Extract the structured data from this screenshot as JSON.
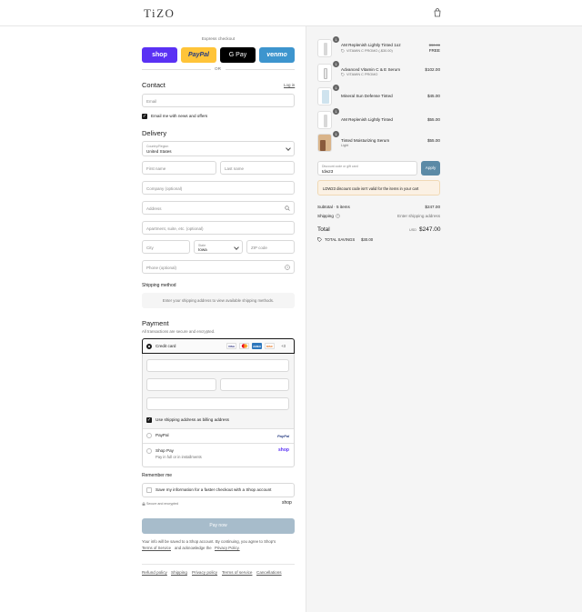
{
  "header": {
    "logo": "TiZO"
  },
  "express": {
    "label": "Express checkout",
    "buttons": [
      "shop",
      "PayPal",
      "G Pay",
      "venmo"
    ],
    "or": "OR"
  },
  "contact": {
    "title": "Contact",
    "login": "Log in",
    "email_placeholder": "Email",
    "newsletter": "Email me with news and offers"
  },
  "delivery": {
    "title": "Delivery",
    "country_label": "Country/Region",
    "country_value": "United States",
    "first_name": "First name",
    "last_name": "Last name",
    "company": "Company (optional)",
    "address": "Address",
    "apartment": "Apartment, suite, etc. (optional)",
    "city": "City",
    "state_label": "State",
    "state_value": "Iowa",
    "zip": "ZIP code",
    "phone": "Phone (optional)"
  },
  "shipping": {
    "title": "Shipping method",
    "message": "Enter your shipping address to view available shipping methods."
  },
  "payment": {
    "title": "Payment",
    "subtitle": "All transactions are secure and encrypted.",
    "credit_card": "Credit card",
    "card_more": "+3",
    "billing_same": "Use shipping address as billing address",
    "paypal": "PayPal",
    "shop_pay": "Shop Pay",
    "shop_pay_sub": "Pay in full or in installments"
  },
  "remember": {
    "title": "Remember me",
    "save_info": "Save my information for a faster checkout with a Shop account",
    "secure": "Secure and encrypted",
    "shop": "shop"
  },
  "pay_now": "Pay now",
  "legal": {
    "line1": "Your info will be saved to a Shop account. By continuing, you agree to Shop's",
    "tos": "Terms of Service",
    "and": "and acknowledge the",
    "privacy": "Privacy Policy."
  },
  "footer": [
    "Refund policy",
    "Shipping",
    "Privacy policy",
    "Terms of service",
    "Cancellations"
  ],
  "cart": {
    "items": [
      {
        "qty": "1",
        "name": "AM Replenish Lightly Tinted 1oz",
        "promo": "VITAMIN C PROMO (-$30.00)",
        "price_old": "$30.00",
        "price": "FREE"
      },
      {
        "qty": "1",
        "name": "Advanced Vitamin C & E Serum",
        "promo": "VITAMIN C PROMO",
        "price": "$102.00"
      },
      {
        "qty": "1",
        "name": "Mineral Sun Defense Tinted",
        "price": "$45.00"
      },
      {
        "qty": "1",
        "name": "AM Replenish Lightly Tinted",
        "price": "$55.00"
      },
      {
        "qty": "1",
        "name": "Tinted Moisturizing Serum",
        "variant": "Light",
        "price": "$55.00"
      }
    ],
    "discount_label": "Discount code or gift card",
    "discount_value": "tdw23",
    "apply": "Apply",
    "error": "LDW23 discount code isn't valid for the items in your cart",
    "subtotal_label": "Subtotal · 5 items",
    "subtotal": "$247.00",
    "shipping_label": "Shipping",
    "shipping_value": "Enter shipping address",
    "total_label": "Total",
    "currency": "USD",
    "total": "$247.00",
    "savings_label": "TOTAL SAVINGS",
    "savings": "$30.00"
  },
  "colors": {
    "accent": "#2a6bbf",
    "pay_button": "#a7bccb",
    "apply": "#5b8aa6",
    "shop_purple": "#5a31f4",
    "paypal_yellow": "#ffc439",
    "venmo_blue": "#3d95ce",
    "error_bg": "#fbf1e4"
  }
}
